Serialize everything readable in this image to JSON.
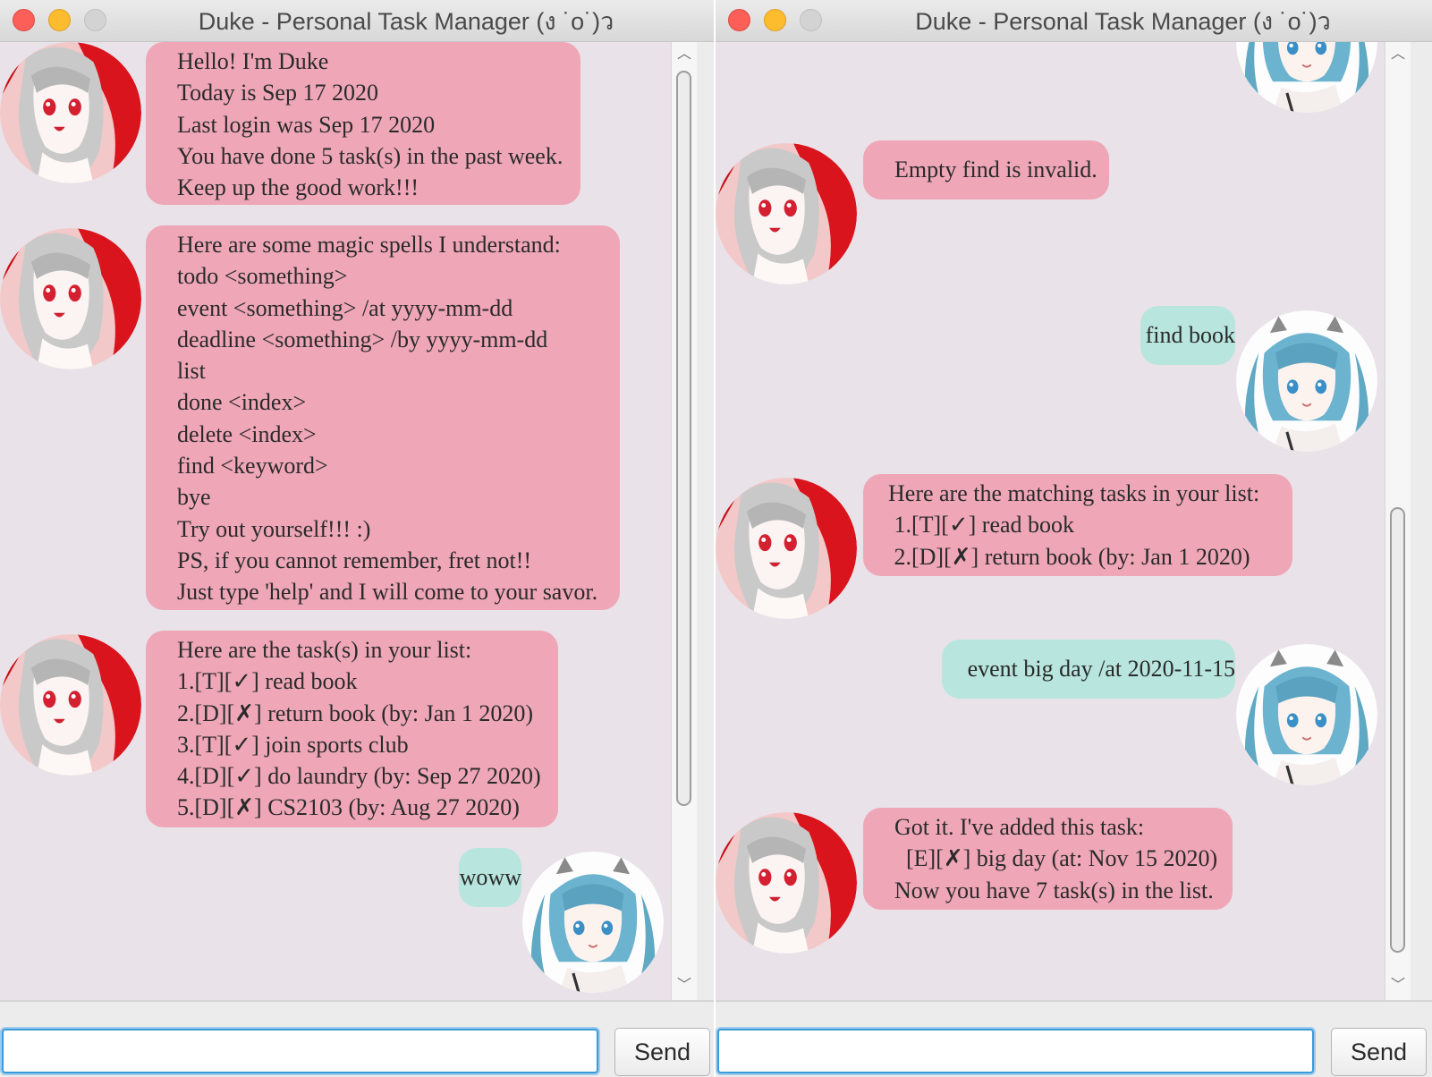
{
  "colors": {
    "chat_bg": "#e9e2e8",
    "duke_bubble": "#efa7b8",
    "user_bubble": "#b8e6df",
    "input_focus": "#3a9bda"
  },
  "windows": [
    {
      "title": "Duke - Personal Task Manager (ง ˙o˙)ว",
      "send_label": "Send",
      "input_value": "",
      "messages": [
        {
          "from": "duke",
          "text": "Hello! I'm Duke\nToday is Sep 17 2020\nLast login was Sep 17 2020\nYou have done 5 task(s) in the past week.\nKeep up the good work!!!"
        },
        {
          "from": "duke",
          "text": "Here are some magic spells I understand:\ntodo <something>\nevent <something> /at yyyy-mm-dd\ndeadline <something> /by yyyy-mm-dd\nlist\ndone <index>\ndelete <index>\nfind <keyword>\nbye\nTry out yourself!!! :)\nPS, if you cannot remember, fret not!!\nJust type 'help' and I will come to your savor."
        },
        {
          "from": "duke",
          "text": "Here are the task(s) in your list:\n1.[T][✓] read book\n2.[D][✗] return book (by: Jan 1 2020)\n3.[T][✓] join sports club\n4.[D][✓] do laundry (by: Sep 27 2020)\n5.[D][✗] CS2103 (by: Aug 27 2020)"
        },
        {
          "from": "user",
          "text": "woww"
        }
      ]
    },
    {
      "title": "Duke - Personal Task Manager (ง ˙o˙)ว",
      "send_label": "Send",
      "input_value": "",
      "messages": [
        {
          "from": "user",
          "text": ""
        },
        {
          "from": "duke",
          "text": "Empty find is invalid."
        },
        {
          "from": "user",
          "text": "find book"
        },
        {
          "from": "duke",
          "text": "Here are the matching tasks in your list:\n 1.[T][✓] read book\n 2.[D][✗] return book (by: Jan 1 2020)"
        },
        {
          "from": "user",
          "text": "event big day /at 2020-11-15"
        },
        {
          "from": "duke",
          "text": "Got it. I've added this task:\n  [E][✗] big day (at: Nov 15 2020)\nNow you have 7 task(s) in the list."
        }
      ]
    }
  ]
}
